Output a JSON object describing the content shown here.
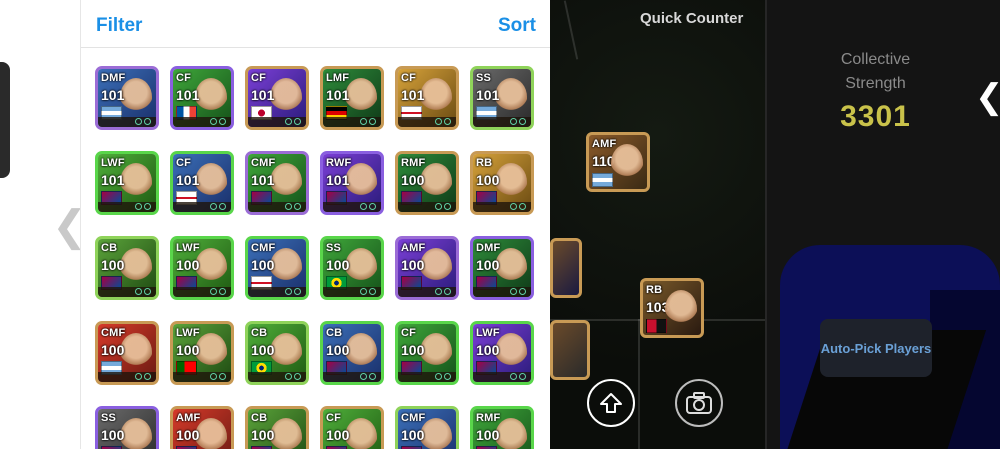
{
  "panel": {
    "filter_label": "Filter",
    "sort_label": "Sort"
  },
  "players": [
    {
      "pos": "DMF",
      "rating": "101",
      "flag": "arg"
    },
    {
      "pos": "CF",
      "rating": "101",
      "flag": "fra"
    },
    {
      "pos": "CF",
      "rating": "101",
      "flag": "jpn"
    },
    {
      "pos": "LMF",
      "rating": "101",
      "flag": "ger"
    },
    {
      "pos": "CF",
      "rating": "101",
      "flag": "eng"
    },
    {
      "pos": "SS",
      "rating": "101",
      "flag": "arg"
    },
    {
      "pos": "LWF",
      "rating": "101",
      "flag": "club"
    },
    {
      "pos": "CF",
      "rating": "101",
      "flag": "eng"
    },
    {
      "pos": "CMF",
      "rating": "101",
      "flag": "club"
    },
    {
      "pos": "RWF",
      "rating": "101",
      "flag": "club"
    },
    {
      "pos": "RMF",
      "rating": "100",
      "flag": "club"
    },
    {
      "pos": "RB",
      "rating": "100",
      "flag": "club"
    },
    {
      "pos": "CB",
      "rating": "100",
      "flag": "club"
    },
    {
      "pos": "LWF",
      "rating": "100",
      "flag": "club"
    },
    {
      "pos": "CMF",
      "rating": "100",
      "flag": "eng"
    },
    {
      "pos": "SS",
      "rating": "100",
      "flag": "bra"
    },
    {
      "pos": "AMF",
      "rating": "100",
      "flag": "club"
    },
    {
      "pos": "DMF",
      "rating": "100",
      "flag": "club"
    },
    {
      "pos": "CMF",
      "rating": "100",
      "flag": "arg"
    },
    {
      "pos": "LWF",
      "rating": "100",
      "flag": "por"
    },
    {
      "pos": "CB",
      "rating": "100",
      "flag": "bra"
    },
    {
      "pos": "CB",
      "rating": "100",
      "flag": "club"
    },
    {
      "pos": "CF",
      "rating": "100",
      "flag": "club"
    },
    {
      "pos": "LWF",
      "rating": "100",
      "flag": "club"
    },
    {
      "pos": "SS",
      "rating": "100",
      "flag": "club"
    },
    {
      "pos": "AMF",
      "rating": "100",
      "flag": "club"
    },
    {
      "pos": "CB",
      "rating": "100",
      "flag": "club"
    },
    {
      "pos": "CF",
      "rating": "100",
      "flag": "club"
    },
    {
      "pos": "CMF",
      "rating": "100",
      "flag": "club"
    },
    {
      "pos": "RMF",
      "rating": "100",
      "flag": "club"
    }
  ],
  "pitch": {
    "title": "Quick Counter",
    "amf_pos": "AMF",
    "amf_rating": "110",
    "rb_pos": "RB",
    "rb_rating": "103"
  },
  "summary": {
    "label": "Collective Strength",
    "value": "3301",
    "autopick_label": "Auto-Pick Players"
  },
  "icons": {
    "left_nav": "chevron-left-icon",
    "right_nav": "chevron-right-icon",
    "upload": "arrow-up-icon",
    "camera": "camera-icon"
  },
  "colors": {
    "accent": "#1a8fe6",
    "strength": "#c9c24a",
    "autopick_text": "#6aa0d6"
  }
}
